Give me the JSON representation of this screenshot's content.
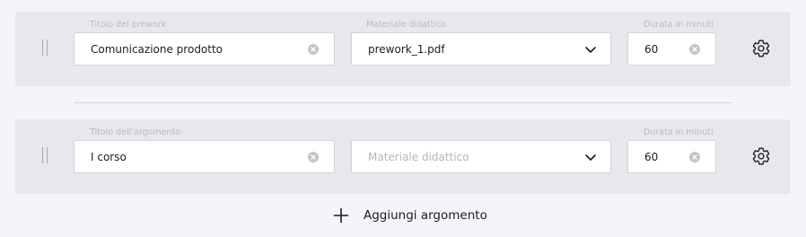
{
  "rows": [
    {
      "title_label": "Titolo del prework",
      "title_value": "Comunicazione prodotto",
      "material_label": "Materiale didattico",
      "material_value": "prework_1.pdf",
      "duration_label": "Durata in minuti",
      "duration_value": "60"
    },
    {
      "title_label": "Titolo dell'argomento",
      "title_value": "I corso",
      "material_label": "",
      "material_placeholder": "Materiale didattico",
      "duration_label": "Durata in minuti",
      "duration_value": "60"
    }
  ],
  "add_button_label": "Aggiungi argomento",
  "icons": {
    "drag": "drag-handle-icon",
    "clear": "clear-circle-icon",
    "dropdown": "chevron-down-icon",
    "settings": "gear-icon",
    "add": "plus-icon"
  },
  "colors": {
    "background": "#f5f5f9",
    "row_background": "#e8e8ec",
    "field_border": "#d3d3d8",
    "label": "#b9b9bf",
    "text": "#1c1c1e"
  }
}
